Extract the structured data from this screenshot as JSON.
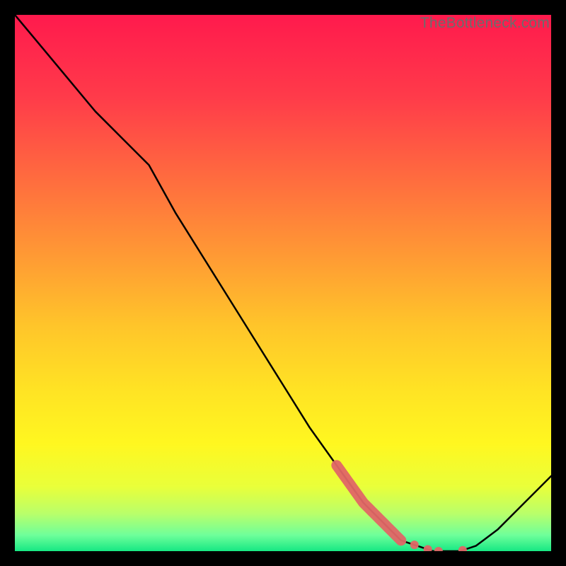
{
  "watermark": "TheBottleneck.com",
  "chart_data": {
    "type": "line",
    "x": [
      0.0,
      0.05,
      0.1,
      0.15,
      0.2,
      0.25,
      0.3,
      0.35,
      0.4,
      0.45,
      0.5,
      0.55,
      0.6,
      0.65,
      0.7,
      0.72,
      0.75,
      0.78,
      0.8,
      0.83,
      0.86,
      0.9,
      0.95,
      1.0
    ],
    "y": [
      1.0,
      0.94,
      0.88,
      0.82,
      0.77,
      0.72,
      0.63,
      0.55,
      0.47,
      0.39,
      0.31,
      0.23,
      0.16,
      0.09,
      0.04,
      0.02,
      0.01,
      0.0,
      0.0,
      0.0,
      0.01,
      0.04,
      0.09,
      0.14
    ],
    "highlight_band": {
      "x0": 0.6,
      "x1": 0.72,
      "note": "thick salmon segment on the descending curve"
    },
    "highlight_dots_x": [
      0.745,
      0.77,
      0.79,
      0.835
    ],
    "green_band": {
      "y0": 0.0,
      "y1": 0.06
    },
    "title": "",
    "xlabel": "",
    "ylabel": "",
    "xlim": [
      0,
      1
    ],
    "ylim": [
      0,
      1
    ],
    "background": {
      "type": "vertical-gradient",
      "stops": [
        {
          "pos": 0.0,
          "color": "#ff1a4d"
        },
        {
          "pos": 0.15,
          "color": "#ff3a4a"
        },
        {
          "pos": 0.3,
          "color": "#ff6a3f"
        },
        {
          "pos": 0.45,
          "color": "#ff9a34"
        },
        {
          "pos": 0.58,
          "color": "#ffc52a"
        },
        {
          "pos": 0.7,
          "color": "#ffe324"
        },
        {
          "pos": 0.8,
          "color": "#fff720"
        },
        {
          "pos": 0.88,
          "color": "#e9ff3a"
        },
        {
          "pos": 0.93,
          "color": "#b9ff6a"
        },
        {
          "pos": 0.97,
          "color": "#6fff9a"
        },
        {
          "pos": 1.0,
          "color": "#17e884"
        }
      ]
    },
    "colors": {
      "curve": "#000000",
      "highlight": "#e06666"
    }
  }
}
